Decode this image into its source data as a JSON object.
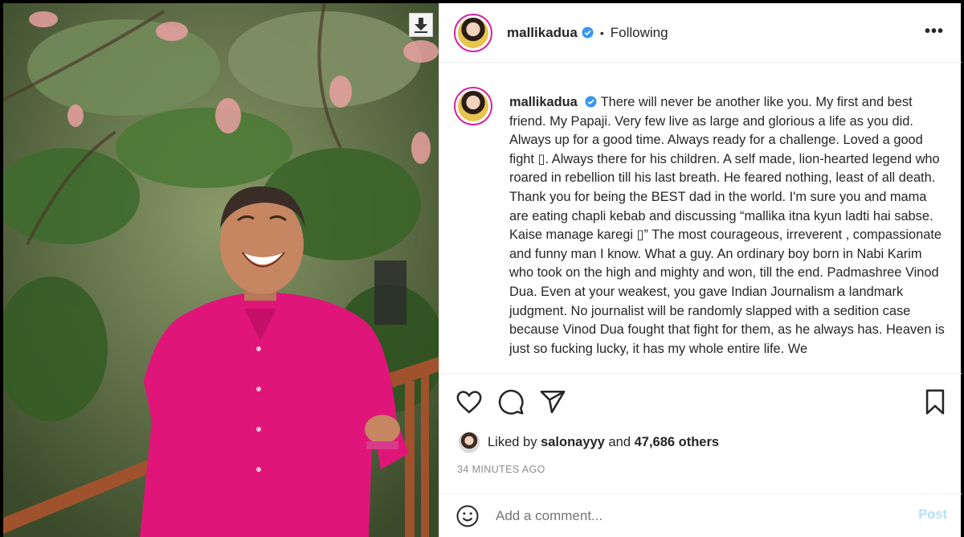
{
  "post": {
    "username": "mallikadua",
    "separator": "•",
    "follow_status": "Following",
    "more_label": "•••",
    "caption": "There will never be another like you. My first and best friend. My Papaji. Very few live as large and glorious a life as you did. Always up for a good time. Always ready for a challenge. Loved a good fight ▯. Always there for his children. A self made, lion-hearted legend who roared in rebellion till his last breath. He feared nothing, least of all death. Thank you for being the BEST dad in the world. I'm sure you and mama are eating chapli kebab and discussing “mallika itna kyun ladti hai sabse. Kaise manage karegi ▯” The most courageous, irreverent , compassionate and funny man I know. What a guy. An ordinary boy born in Nabi Karim who took on the high and mighty and won, till the end. Padmashree Vinod Dua. Even at your weakest, you gave Indian Journalism a landmark judgment. No journalist will be randomly slapped with a sedition case because Vinod Dua fought that fight for them, as he always has. Heaven is just so fucking lucky, it has my whole entire life. We",
    "liked_by_prefix": "Liked by",
    "liked_by_user": "salonayyy",
    "liked_by_and": "and",
    "liked_by_others": "47,686 others",
    "timestamp": "34 MINUTES AGO",
    "comment_placeholder": "Add a comment...",
    "post_label": "Post"
  },
  "icons": {
    "like": "heart-icon",
    "comment": "comment-icon",
    "share": "paper-plane-icon",
    "save": "bookmark-icon",
    "emoji": "emoji-icon",
    "verified": "verified-badge-icon",
    "download": "download-icon"
  },
  "colors": {
    "shirt": "#e0157a",
    "verified": "#3897f0",
    "post_button": "#b2dffc",
    "muted_text": "#8e8e8e"
  }
}
